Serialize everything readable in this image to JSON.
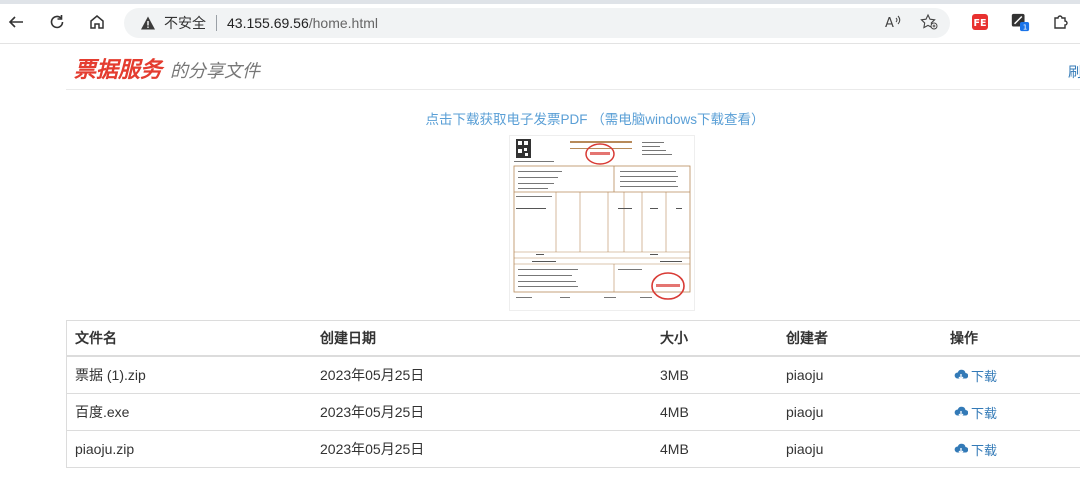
{
  "browser": {
    "insecure_label": "不安全",
    "url_host": "43.155.69.56",
    "url_path": "/home.html"
  },
  "header": {
    "brand": "票据服务",
    "subtitle": "的分享文件",
    "refresh_label": "刷"
  },
  "pdf_link": "点击下载获取电子发票PDF （需电脑windows下载查看）",
  "table": {
    "headers": [
      "文件名",
      "创建日期",
      "大小",
      "创建者",
      "操作"
    ],
    "rows": [
      {
        "name": "票据 (1).zip",
        "date": "2023年05月25日",
        "size": "3MB",
        "creator": "piaoju",
        "action": "下载"
      },
      {
        "name": "百度.exe",
        "date": "2023年05月25日",
        "size": "4MB",
        "creator": "piaoju",
        "action": "下载"
      },
      {
        "name": "piaoju.zip",
        "date": "2023年05月25日",
        "size": "4MB",
        "creator": "piaoju",
        "action": "下载"
      }
    ]
  },
  "colors": {
    "brand_red": "#e43c2f",
    "link_blue": "#337ab7",
    "pdf_link_blue": "#5a9fd6"
  }
}
